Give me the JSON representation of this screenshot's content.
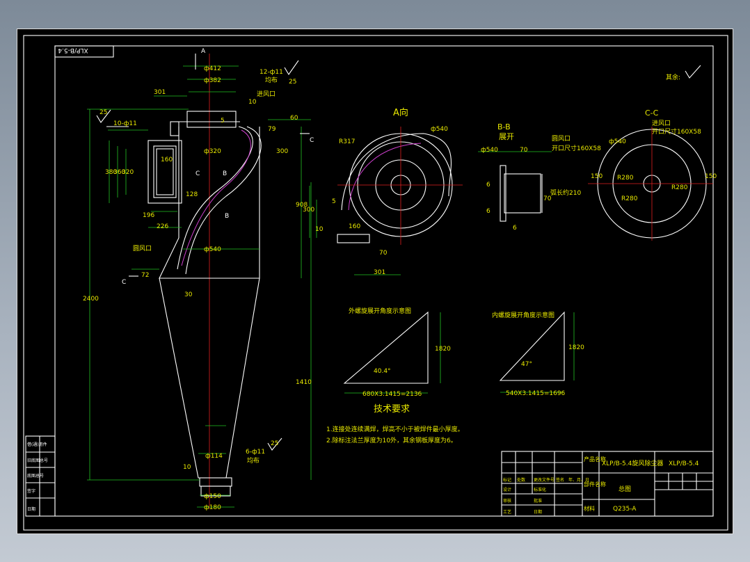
{
  "drawing_code": "XLP/B-5.4",
  "front_view": {
    "dims": [
      "ф412",
      "ф382",
      "ф320",
      "12-ф11",
      "均布",
      "25",
      "301",
      "ф540",
      "10",
      "5",
      "79",
      "60",
      "300",
      "908",
      "2400",
      "1410",
      "380",
      "360",
      "320",
      "160",
      "196",
      "226",
      "128",
      "ф114",
      "ф150",
      "ф180",
      "10",
      "6-ф11",
      "均布",
      "25",
      "10-ф11",
      "25",
      "72",
      "30"
    ],
    "labels": {
      "section_a": "A",
      "section_b": "B",
      "section_c": "C",
      "inlet": "进风口",
      "round_outlet": "圆风口"
    }
  },
  "view_a": {
    "title": "A向",
    "dims": [
      "R317",
      "ф540",
      "5",
      "300",
      "10",
      "160",
      "70",
      "301"
    ]
  },
  "view_bb": {
    "title": "B-B",
    "subtitle": "展开",
    "dims": [
      "ф540",
      "70",
      "6",
      "6",
      "70",
      "6"
    ],
    "notes": [
      "圆风口",
      "开口尺寸160X58",
      "弧长约210"
    ]
  },
  "view_cc": {
    "title": "C-C",
    "notes": [
      "进风口",
      "开口尺寸160X58"
    ],
    "dims": [
      "ф540",
      "R280",
      "R280",
      "R280",
      "150",
      "150"
    ]
  },
  "other_mark": "其余:",
  "outer_triangle": {
    "title": "外螺旋展开角度示意图",
    "angle": "40.4°",
    "height": "1820",
    "base": "680X3.1415=2136"
  },
  "inner_triangle": {
    "title": "内螺旋展开角度示意图",
    "angle": "47°",
    "height": "1820",
    "base": "540X3.1415=1696"
  },
  "notes": {
    "heading": "技术要求",
    "items": [
      "1.连接处连续满焊，焊高不小于被焊件最小厚度。",
      "2.除标注法兰厚度为10外，其余钢板厚度为6。"
    ]
  },
  "title_block": {
    "product_label": "产品名称",
    "product_name": "XLP/B-5.4旋风除尘器",
    "drawing_no": "XLP/B-5.4",
    "part_label": "部件名称",
    "part_name": "总图",
    "material_label": "材料",
    "material": "Q235-A",
    "rows": [
      "标记",
      "处数",
      "更改文件号",
      "签名",
      "年、月、日",
      "设计",
      "标准化",
      "审核",
      "工艺",
      "批准",
      "日期"
    ]
  },
  "left_strip": [
    "借(通)用件",
    "旧底图总号",
    "底图总号",
    "签字",
    "日期"
  ]
}
